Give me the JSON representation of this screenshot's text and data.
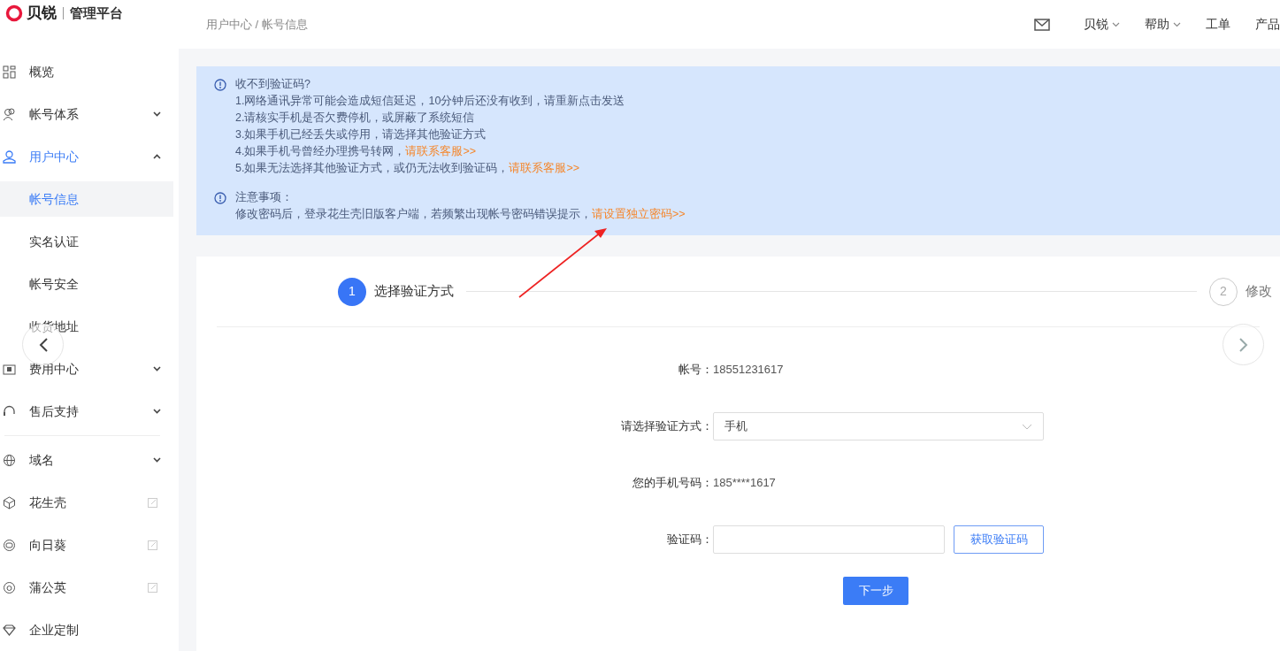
{
  "brand": {
    "name": "贝锐",
    "product": "管理平台"
  },
  "breadcrumb": "用户中心 / 帐号信息",
  "header_menu": [
    {
      "kind": "mail"
    },
    {
      "kind": "dropdown",
      "label": "贝锐"
    },
    {
      "kind": "dropdown",
      "label": "帮助"
    },
    {
      "kind": "plain",
      "label": "工单"
    },
    {
      "kind": "plain",
      "label": "产品"
    }
  ],
  "sidebar": {
    "items": [
      {
        "kind": "plain",
        "label": "概览",
        "selected": false
      },
      {
        "kind": "group",
        "label": "帐号体系",
        "expanded": false
      },
      {
        "kind": "group",
        "label": "用户中心",
        "expanded": true,
        "children": [
          {
            "label": "帐号信息",
            "selected": true
          },
          {
            "label": "实名认证",
            "selected": false
          },
          {
            "label": "帐号安全",
            "selected": false
          },
          {
            "label": "收货地址",
            "selected": false
          }
        ]
      },
      {
        "kind": "group",
        "label": "费用中心",
        "expanded": false
      },
      {
        "kind": "group",
        "label": "售后支持",
        "expanded": false
      },
      {
        "kind": "divider"
      },
      {
        "kind": "group",
        "label": "域名",
        "expanded": false
      },
      {
        "kind": "link",
        "label": "花生壳",
        "selected": false
      },
      {
        "kind": "link",
        "label": "向日葵",
        "selected": false
      },
      {
        "kind": "link",
        "label": "蒲公英",
        "selected": false
      },
      {
        "kind": "plain",
        "label": "企业定制",
        "selected": false
      }
    ]
  },
  "notice": [
    {
      "title": "收不到验证码?",
      "lines": [
        {
          "text": "1.网络通讯异常可能会造成短信延迟，10分钟后还没有收到，请重新点击发送"
        },
        {
          "text": "2.请核实手机是否欠费停机，或屏蔽了系统短信"
        },
        {
          "text": "3.如果手机已经丢失或停用，请选择其他验证方式"
        },
        {
          "text": "4.如果手机号曾经办理携号转网，",
          "link": "请联系客服>>"
        },
        {
          "text": "5.如果无法选择其他验证方式，或仍无法收到验证码，",
          "link": "请联系客服>>"
        }
      ]
    },
    {
      "title": "注意事项：",
      "lines": [
        {
          "text": "修改密码后，登录花生壳旧版客户端，若频繁出现帐号密码错误提示，",
          "link": "请设置独立密码>>"
        }
      ]
    }
  ],
  "steps": [
    {
      "number": "1",
      "label": "选择验证方式",
      "active": true
    },
    {
      "number": "2",
      "label": "修改",
      "active": false
    }
  ],
  "form": [
    {
      "kind": "text",
      "label": "帐号：",
      "value": "18551231617"
    },
    {
      "kind": "select",
      "label": "请选择验证方式：",
      "value": "手机"
    },
    {
      "kind": "text",
      "label": "您的手机号码：",
      "value": "185****1617"
    },
    {
      "kind": "code",
      "label": "验证码：",
      "button": "获取验证码"
    }
  ],
  "submit": "下一步"
}
